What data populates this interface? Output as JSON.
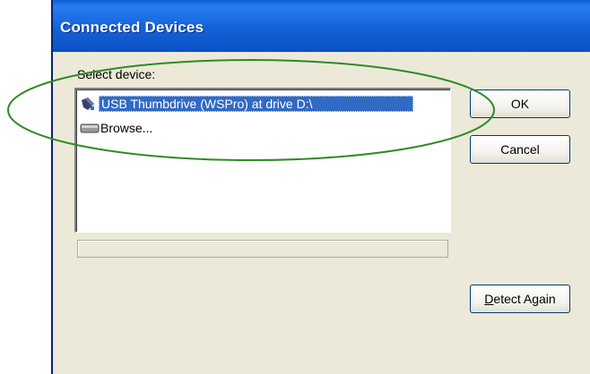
{
  "window": {
    "title": "Connected Devices"
  },
  "dialog": {
    "select_label": "Select device:",
    "devices": [
      {
        "label": "USB Thumbdrive (WSPro) at drive D:\\",
        "icon": "usb-drive-icon",
        "selected": true
      },
      {
        "label": "Browse...",
        "icon": "drive-icon",
        "selected": false
      }
    ],
    "progress": 0,
    "buttons": {
      "ok": "OK",
      "cancel": "Cancel",
      "detect_again_accel": "D",
      "detect_again_rest": "etect Again"
    }
  },
  "colors": {
    "titlebar": "#0b5ad8",
    "selection": "#316ac5",
    "dialog_bg": "#ece9d8",
    "annotation_ellipse": "#2e8a25"
  }
}
